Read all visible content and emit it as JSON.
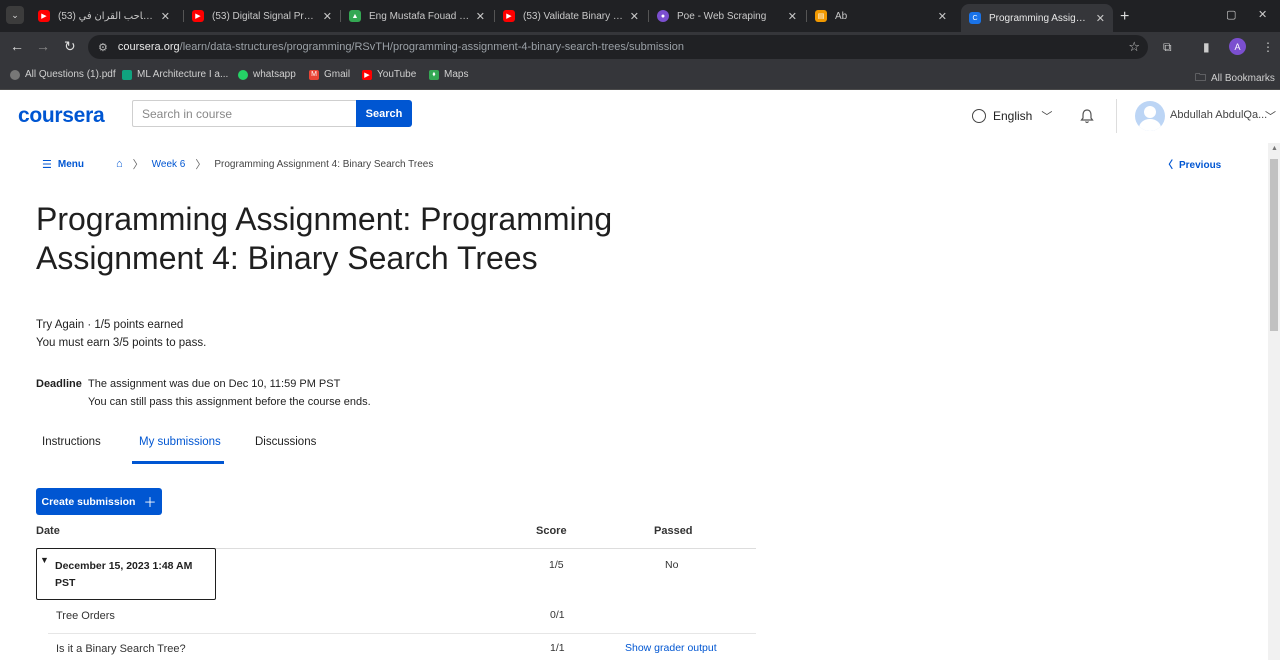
{
  "browser": {
    "tabs": [
      {
        "title": "(53) إراي تصاحب القرآن في",
        "color": "#ff0000"
      },
      {
        "title": "(53) Digital Signal Process",
        "color": "#ff0000"
      },
      {
        "title": "Eng Mustafa Fouad - Goo",
        "color": "#34a853"
      },
      {
        "title": "(53) Validate Binary Search",
        "color": "#ff0000"
      },
      {
        "title": "Poe - Web Scraping",
        "color": "#7b4fcf"
      },
      {
        "title": "Ab",
        "color": "#f29900"
      },
      {
        "title": "Programming Assignment",
        "color": "#1a73e8"
      }
    ],
    "url": {
      "host": "coursera.org",
      "path": "/learn/data-structures/programming/RSvTH/programming-assignment-4-binary-search-trees/submission"
    },
    "profile_initial": "A",
    "bookmarks": [
      {
        "label": "All Questions (1).pdf",
        "color": "#777"
      },
      {
        "label": "ML Architecture I a...",
        "color": "#10a37f"
      },
      {
        "label": "whatsapp",
        "color": "#25d366"
      },
      {
        "label": "Gmail",
        "color": "#ea4335"
      },
      {
        "label": "YouTube",
        "color": "#ff0000"
      },
      {
        "label": "Maps",
        "color": "#34a853"
      }
    ],
    "all_bookmarks": "All Bookmarks"
  },
  "header": {
    "logo": "coursera",
    "search_placeholder": "Search in course",
    "search_button": "Search",
    "language": "English",
    "user_name": "Abdullah AbdulQa..."
  },
  "breadcrumb": {
    "menu": "Menu",
    "week": "Week 6",
    "current": "Programming Assignment 4: Binary Search Trees",
    "previous": "Previous"
  },
  "page": {
    "title": "Programming Assignment: Programming Assignment 4: Binary Search Trees",
    "grade_line1": "Try Again · 1/5 points earned",
    "grade_line2": "You must earn 3/5 points to pass.",
    "deadline_label": "Deadline",
    "deadline_line1": "The assignment was due on Dec 10, 11:59 PM PST",
    "deadline_line2": "You can still pass this assignment before the course ends."
  },
  "content_tabs": {
    "instructions": "Instructions",
    "submissions": "My submissions",
    "discussions": "Discussions"
  },
  "create_submission": "Create submission",
  "table": {
    "headers": {
      "date": "Date",
      "score": "Score",
      "passed": "Passed"
    },
    "submission": {
      "date": "December 15, 2023 1:48 AM PST",
      "score": "1/5",
      "passed": "No"
    },
    "parts": [
      {
        "name": "Tree Orders",
        "score": "0/1",
        "action": ""
      },
      {
        "name": "Is it a Binary Search Tree?",
        "score": "1/1",
        "action": "Show grader output"
      }
    ]
  }
}
